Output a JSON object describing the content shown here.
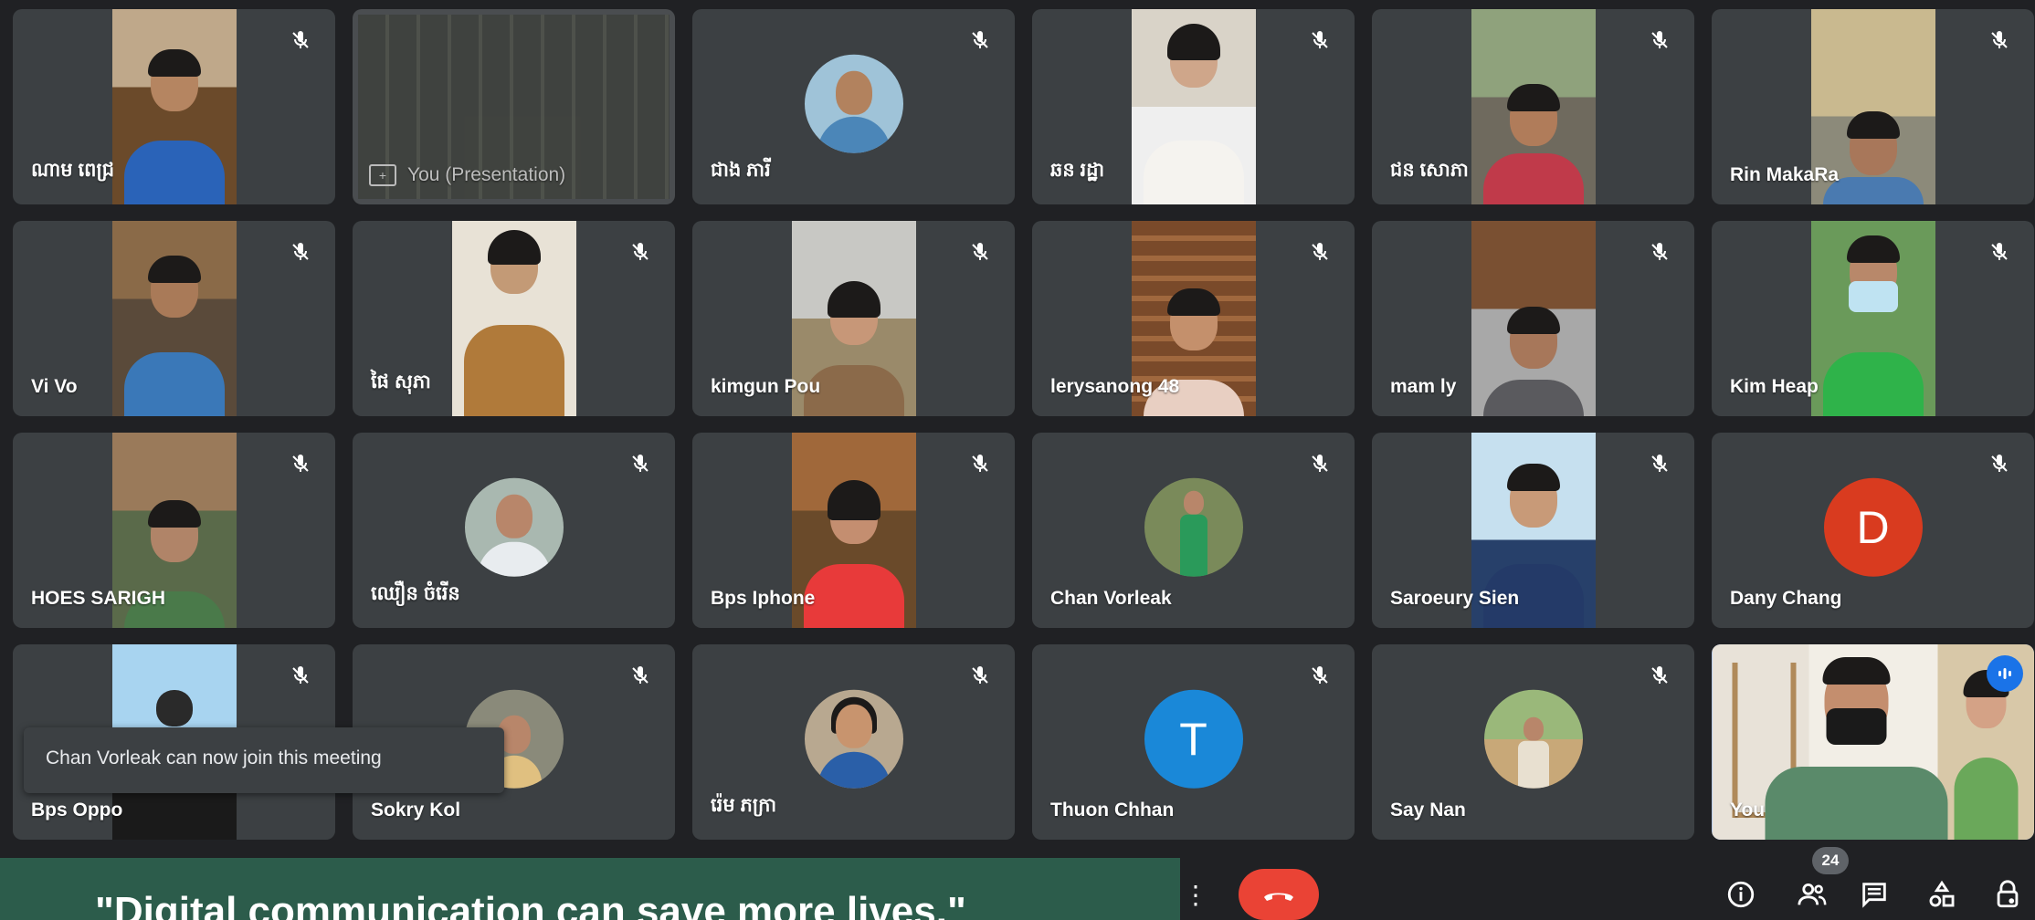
{
  "participants": [
    {
      "name": "ណាម ពេជ្រ",
      "kind": "video"
    },
    {
      "name": "You (Presentation)",
      "kind": "presentation"
    },
    {
      "name": "ជាង ភារី",
      "kind": "photo"
    },
    {
      "name": "ឆន រដ្ឋា",
      "kind": "video"
    },
    {
      "name": "ជន សោភា",
      "kind": "video"
    },
    {
      "name": "Rin MakaRa",
      "kind": "video"
    },
    {
      "name": "Vi Vo",
      "kind": "video"
    },
    {
      "name": "ផៃ សុភា",
      "kind": "video"
    },
    {
      "name": "kimgun Pou",
      "kind": "video"
    },
    {
      "name": "lerysanong 48",
      "kind": "video"
    },
    {
      "name": "mam ly",
      "kind": "video"
    },
    {
      "name": "Kim Heap",
      "kind": "video"
    },
    {
      "name": "HOES SARIGH",
      "kind": "video"
    },
    {
      "name": "ឈឿន ចំរើន",
      "kind": "photo"
    },
    {
      "name": "Bps Iphone",
      "kind": "video"
    },
    {
      "name": "Chan Vorleak",
      "kind": "photo"
    },
    {
      "name": "Saroeury Sien",
      "kind": "video"
    },
    {
      "name": "Dany Chang",
      "kind": "letter",
      "initial": "D",
      "color": "#d93b1f"
    },
    {
      "name": "Bps Oppo",
      "kind": "video"
    },
    {
      "name": "Sokry Kol",
      "kind": "photo"
    },
    {
      "name": "រ៉េម ភក្រា",
      "kind": "photo"
    },
    {
      "name": "Thuon Chhan",
      "kind": "letter",
      "initial": "T",
      "color": "#1a88d8"
    },
    {
      "name": "Say Nan",
      "kind": "photo"
    },
    {
      "name": "You",
      "kind": "self"
    }
  ],
  "toast": {
    "text": "Chan Vorleak can now join this meeting"
  },
  "banner": {
    "text": "\"Digital communication can save more lives.\""
  },
  "toolbar": {
    "participant_count": "24",
    "icons": [
      "more-options-icon",
      "end-call-icon",
      "info-icon",
      "people-icon",
      "chat-icon",
      "activities-icon",
      "host-controls-icon"
    ]
  },
  "colors": {
    "background": "#202124",
    "tile": "#3c4043",
    "end_call": "#ea4335",
    "banner": "#2c5c4b",
    "self_outline": "#8ab4f8"
  }
}
